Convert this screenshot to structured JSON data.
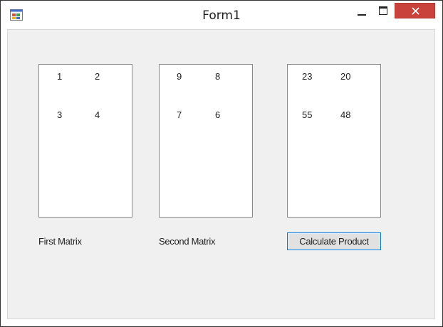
{
  "window": {
    "title": "Form1",
    "icon": "winforms-app-icon",
    "controls": {
      "minimize_icon": "minimize-icon",
      "maximize_icon": "maximize-icon",
      "close_icon": "close-icon",
      "close_color": "#c9423b"
    }
  },
  "form": {
    "first_matrix": {
      "label": "First Matrix",
      "cells": [
        [
          "1",
          "2"
        ],
        [
          "3",
          "4"
        ]
      ]
    },
    "second_matrix": {
      "label": "Second Matrix",
      "cells": [
        [
          "9",
          "8"
        ],
        [
          "7",
          "6"
        ]
      ]
    },
    "result_matrix": {
      "cells": [
        [
          "23",
          "20"
        ],
        [
          "55",
          "48"
        ]
      ]
    },
    "calculate_button": {
      "label": "Calculate Product",
      "border_color": "#0078d7"
    }
  }
}
